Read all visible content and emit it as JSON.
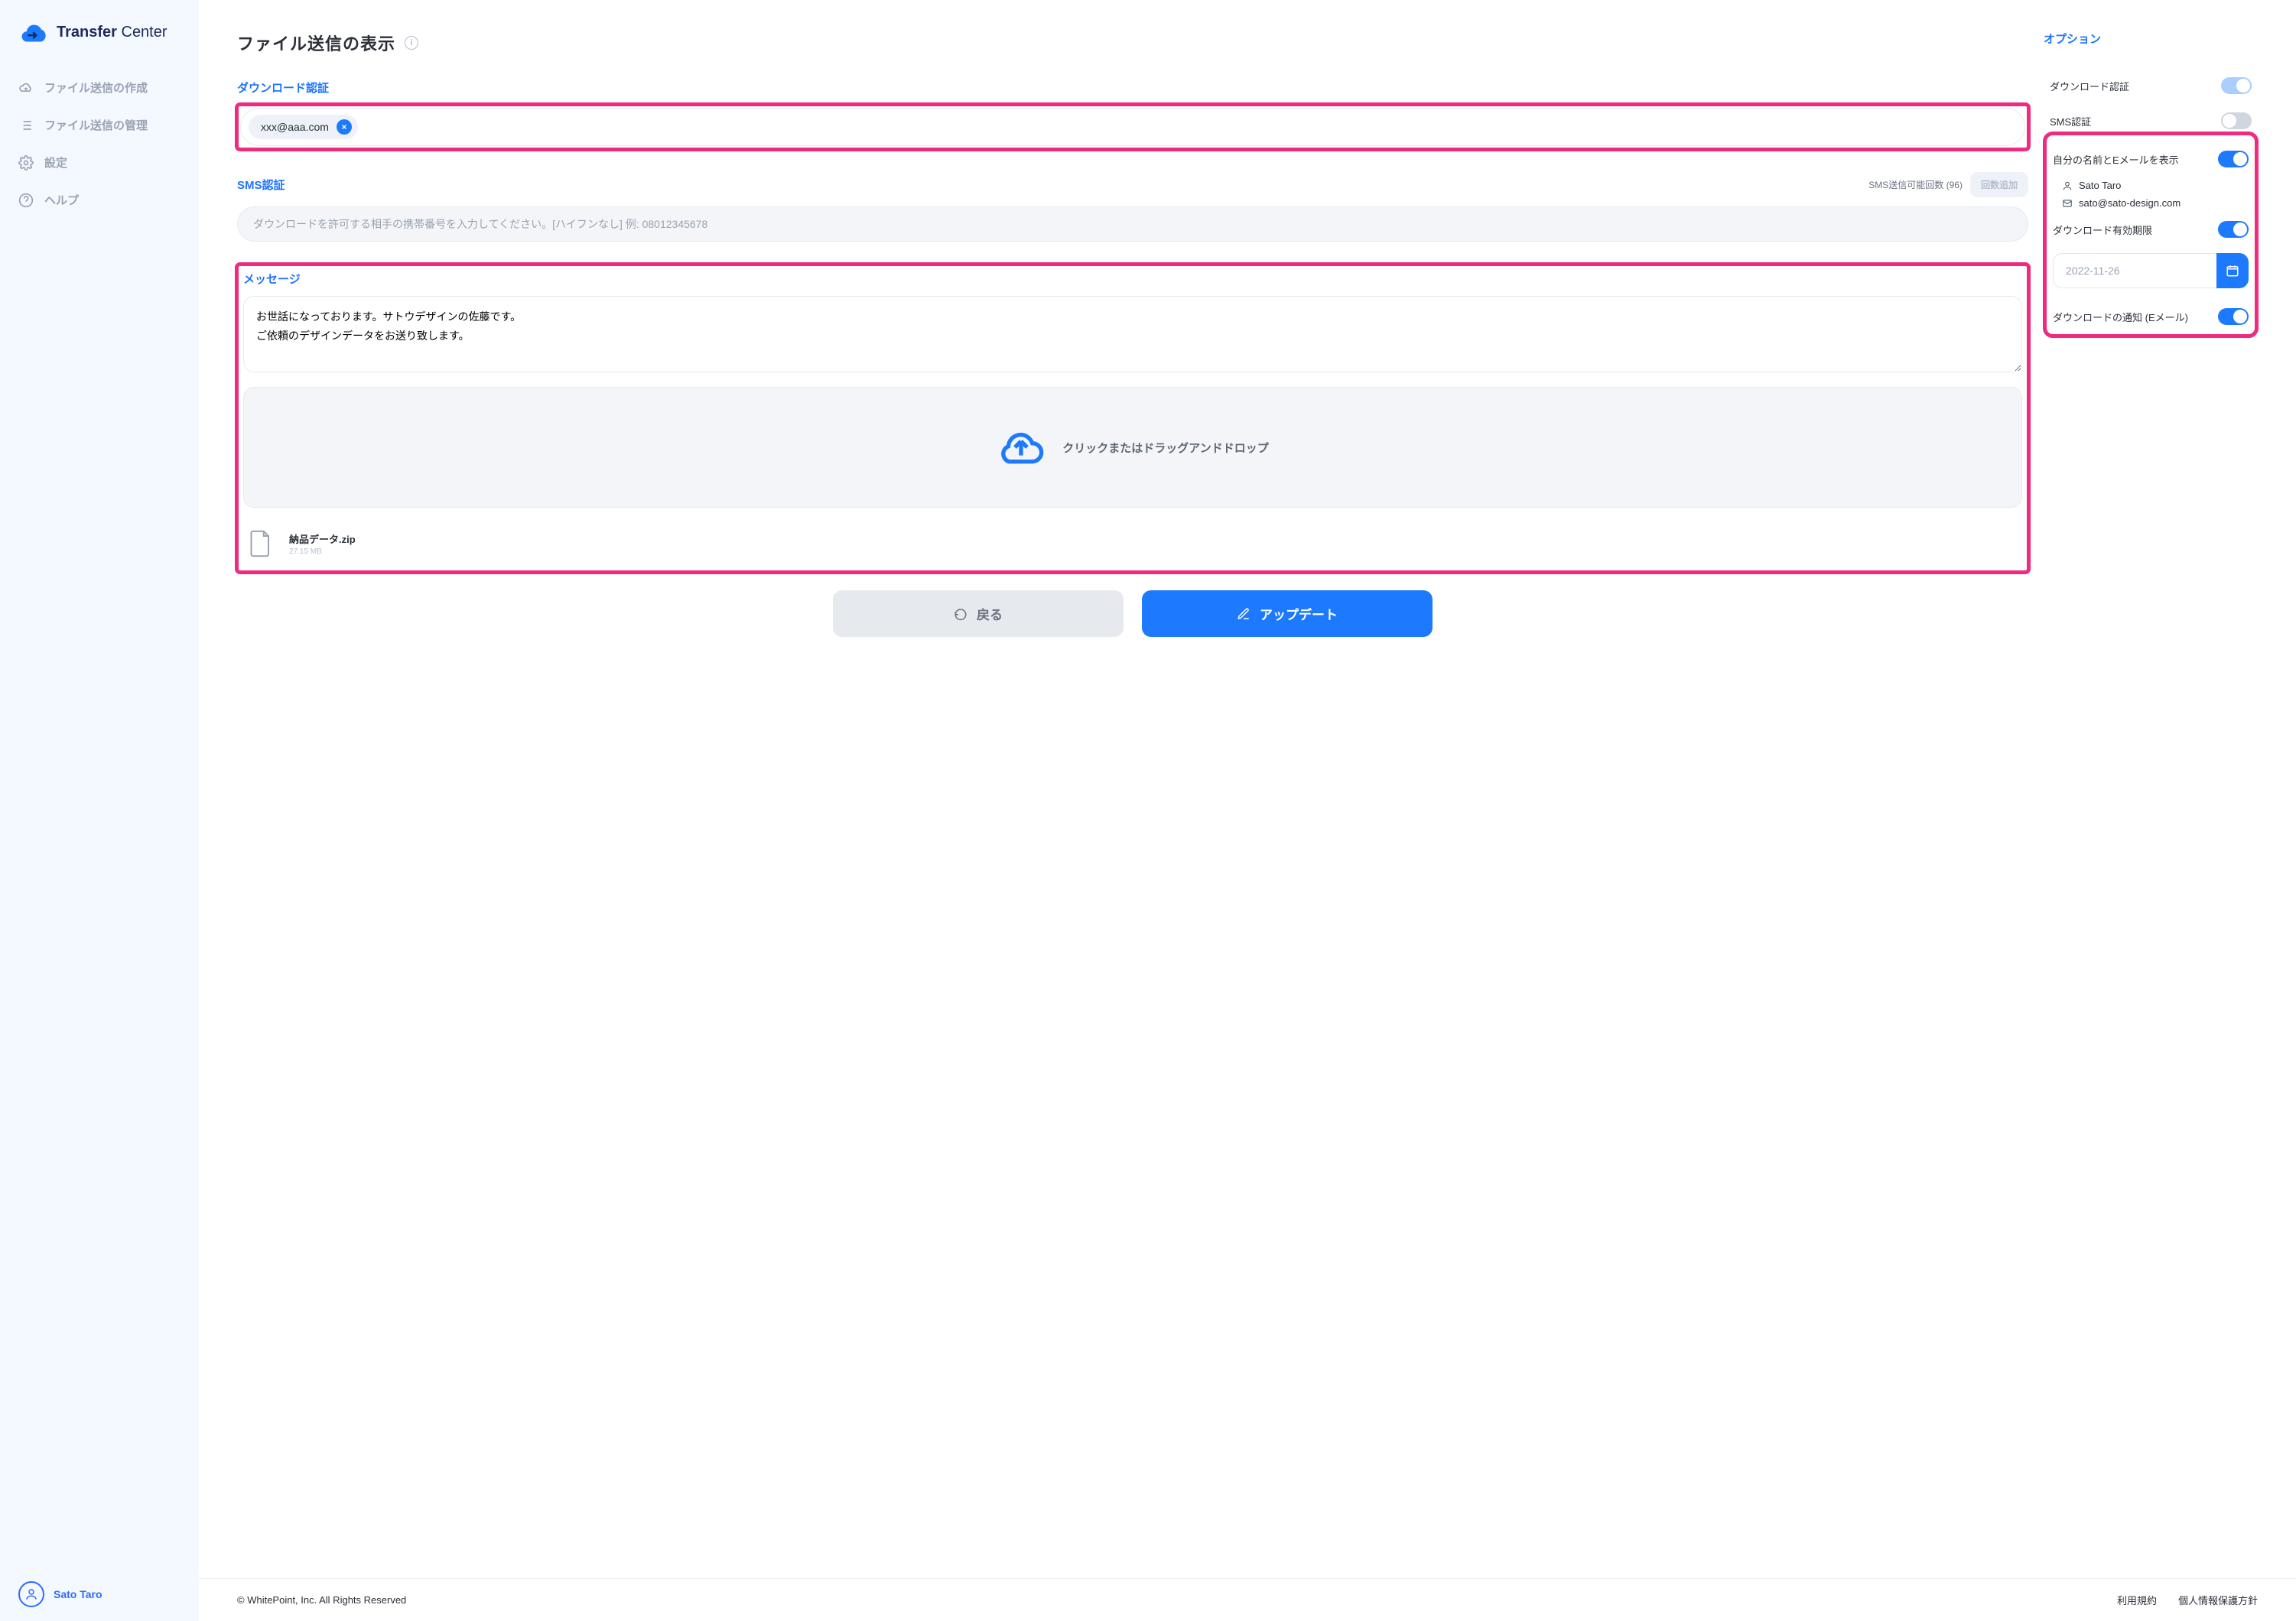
{
  "brand": {
    "word1": "Transfer",
    "word2": " Center"
  },
  "nav": {
    "items": [
      {
        "label": "ファイル送信の作成"
      },
      {
        "label": "ファイル送信の管理"
      },
      {
        "label": "設定"
      },
      {
        "label": "ヘルプ"
      }
    ]
  },
  "current_user": {
    "name": "Sato Taro"
  },
  "page": {
    "title": "ファイル送信の表示",
    "sections": {
      "download_auth": {
        "label": "ダウンロード認証",
        "chips": [
          {
            "value": "xxx@aaa.com"
          }
        ]
      },
      "sms_auth": {
        "label": "SMS認証",
        "remaining_label": "SMS送信可能回数 (96)",
        "add_btn": "回数追加",
        "placeholder": "ダウンロードを許可する相手の携帯番号を入力してください。[ハイフンなし] 例: 08012345678"
      },
      "message": {
        "label": "メッセージ",
        "text": "お世話になっております。サトウデザインの佐藤です。\nご依頼のデザインデータをお送り致します。"
      },
      "dropzone": {
        "label": "クリックまたはドラッグアンドドロップ"
      },
      "files": [
        {
          "name": "納品データ.zip",
          "size": "27.15 MB"
        }
      ]
    },
    "actions": {
      "back": "戻る",
      "update": "アップデート"
    }
  },
  "options": {
    "title": "オプション",
    "rows": {
      "download_auth": {
        "label": "ダウンロード認証",
        "on": true,
        "soft": true
      },
      "sms_auth": {
        "label": "SMS認証",
        "on": false
      },
      "show_sender": {
        "label": "自分の名前とEメールを表示",
        "on": true
      },
      "sender_name": "Sato Taro",
      "sender_email": "sato@sato-design.com",
      "download_expiry": {
        "label": "ダウンロード有効期限",
        "on": true,
        "value": "2022-11-26"
      },
      "notify_email": {
        "label": "ダウンロードの通知 (Eメール)",
        "on": true
      }
    }
  },
  "footer": {
    "copyright": "© WhitePoint, Inc. All Rights Reserved",
    "terms": "利用規約",
    "privacy": "個人情報保護方針"
  }
}
